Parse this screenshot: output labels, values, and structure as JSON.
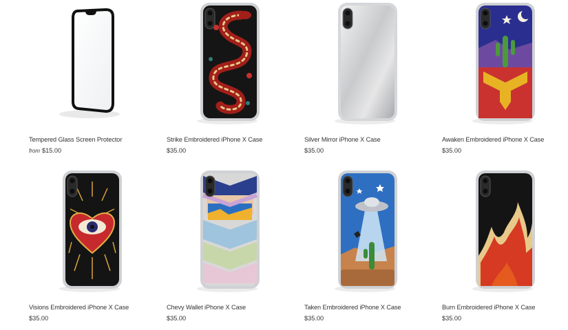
{
  "products": [
    {
      "name": "Tempered Glass Screen Protector",
      "price_prefix": "from",
      "price": "$15.00"
    },
    {
      "name": "Strike Embroidered iPhone X Case",
      "price": "$35.00"
    },
    {
      "name": "Silver Mirror iPhone X Case",
      "price": "$35.00"
    },
    {
      "name": "Awaken Embroidered iPhone X Case",
      "price": "$35.00"
    },
    {
      "name": "Visions Embroidered iPhone X Case",
      "price": "$35.00"
    },
    {
      "name": "Chevy Wallet iPhone X Case",
      "price": "$35.00"
    },
    {
      "name": "Taken Embroidered iPhone X Case",
      "price": "$35.00"
    },
    {
      "name": "Burn Embroidered iPhone X Case",
      "price": "$35.00"
    }
  ]
}
